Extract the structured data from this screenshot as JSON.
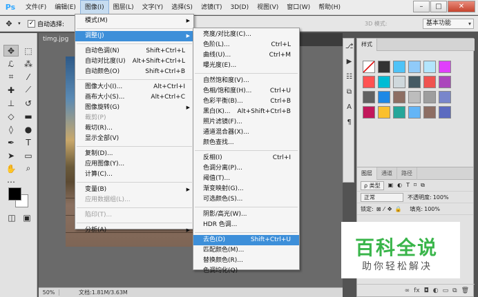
{
  "menubar": {
    "logo": "Ps",
    "items": [
      "文件(F)",
      "编辑(E)",
      "图像(I)",
      "图层(L)",
      "文字(Y)",
      "选择(S)",
      "滤镜(T)",
      "3D(D)",
      "视图(V)",
      "窗口(W)",
      "帮助(H)"
    ],
    "active_index": 2
  },
  "window_controls": {
    "minimize": "–",
    "maximize": "□",
    "close": "✕"
  },
  "options_bar": {
    "auto_select_label": "自动选择:",
    "mode_3d": "3D 模式:",
    "workspace": "基本功能"
  },
  "document": {
    "tab": "timg.jpg",
    "zoom": "50%",
    "doc_info": "文档:1.81M/3.63M"
  },
  "image_menu": {
    "items": [
      {
        "label": "模式(M)",
        "arrow": true
      },
      {
        "sep": true
      },
      {
        "label": "调整(J)",
        "arrow": true,
        "highlight": true
      },
      {
        "sep": true
      },
      {
        "label": "自动色调(N)",
        "shortcut": "Shift+Ctrl+L"
      },
      {
        "label": "自动对比度(U)",
        "shortcut": "Alt+Shift+Ctrl+L"
      },
      {
        "label": "自动颜色(O)",
        "shortcut": "Shift+Ctrl+B"
      },
      {
        "sep": true
      },
      {
        "label": "图像大小(I)...",
        "shortcut": "Alt+Ctrl+I"
      },
      {
        "label": "画布大小(S)...",
        "shortcut": "Alt+Ctrl+C"
      },
      {
        "label": "图像旋转(G)",
        "arrow": true
      },
      {
        "label": "裁剪(P)",
        "disabled": true
      },
      {
        "label": "裁切(R)..."
      },
      {
        "label": "显示全部(V)"
      },
      {
        "sep": true
      },
      {
        "label": "复制(D)..."
      },
      {
        "label": "应用图像(Y)..."
      },
      {
        "label": "计算(C)..."
      },
      {
        "sep": true
      },
      {
        "label": "变量(B)",
        "arrow": true
      },
      {
        "label": "应用数据组(L)...",
        "disabled": true
      },
      {
        "sep": true
      },
      {
        "label": "陷印(T)...",
        "disabled": true
      },
      {
        "sep": true
      },
      {
        "label": "分析(A)",
        "arrow": true
      }
    ]
  },
  "adjust_menu": {
    "items": [
      {
        "label": "亮度/对比度(C)..."
      },
      {
        "label": "色阶(L)...",
        "shortcut": "Ctrl+L"
      },
      {
        "label": "曲线(U)...",
        "shortcut": "Ctrl+M"
      },
      {
        "label": "曝光度(E)..."
      },
      {
        "sep": true
      },
      {
        "label": "自然饱和度(V)..."
      },
      {
        "label": "色相/饱和度(H)...",
        "shortcut": "Ctrl+U"
      },
      {
        "label": "色彩平衡(B)...",
        "shortcut": "Ctrl+B"
      },
      {
        "label": "黑白(K)...",
        "shortcut": "Alt+Shift+Ctrl+B"
      },
      {
        "label": "照片滤镜(F)..."
      },
      {
        "label": "通道混合器(X)..."
      },
      {
        "label": "颜色查找..."
      },
      {
        "sep": true
      },
      {
        "label": "反相(I)",
        "shortcut": "Ctrl+I"
      },
      {
        "label": "色调分离(P)..."
      },
      {
        "label": "阈值(T)..."
      },
      {
        "label": "渐变映射(G)..."
      },
      {
        "label": "可选颜色(S)..."
      },
      {
        "sep": true
      },
      {
        "label": "阴影/高光(W)..."
      },
      {
        "label": "HDR 色调..."
      },
      {
        "sep": true
      },
      {
        "label": "去色(D)",
        "shortcut": "Shift+Ctrl+U",
        "highlight": true
      },
      {
        "label": "匹配颜色(M)..."
      },
      {
        "label": "替换颜色(R)..."
      },
      {
        "label": "色调均化(Q)"
      }
    ]
  },
  "styles_panel": {
    "tab": "样式"
  },
  "layers_panel": {
    "tabs": [
      "图层",
      "通道",
      "路径"
    ],
    "kind_filter": "ρ 类型",
    "blend_mode": "正常",
    "opacity_label": "不透明度:",
    "opacity_value": "100%",
    "lock_label": "锁定:",
    "fill_label": "填充:",
    "fill_value": "100%"
  },
  "watermark": {
    "logo": "百科全说",
    "tagline": "助你轻松解决"
  }
}
